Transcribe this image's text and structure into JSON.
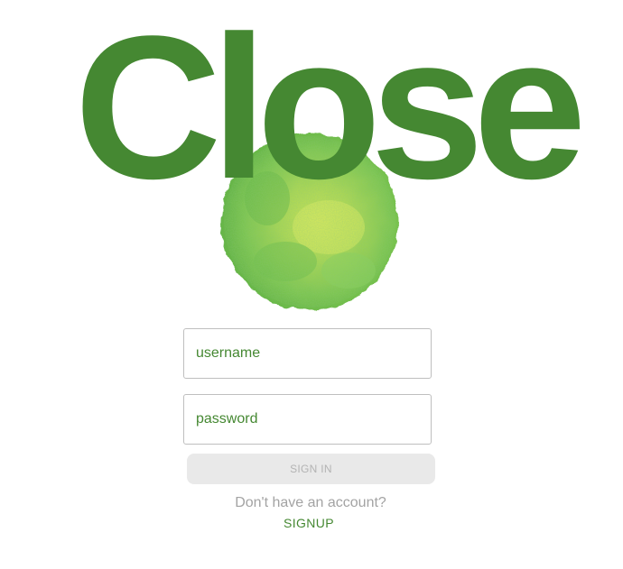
{
  "logo": {
    "title": "Close",
    "image": "watercolor-green-circle",
    "title_color": "#458832"
  },
  "login_form": {
    "username_placeholder": "username",
    "password_placeholder": "password",
    "sign_in_label": "SIGN IN",
    "sign_in_disabled": true,
    "no_account_text": "Don't have an account?",
    "signup_label": "SIGNUP"
  },
  "colors": {
    "accent": "#458832",
    "muted_text": "#a3a3a3",
    "disabled_button_bg": "#e9e9e9",
    "disabled_button_text": "#b3b3b3",
    "input_border": "#bfbfbf"
  }
}
